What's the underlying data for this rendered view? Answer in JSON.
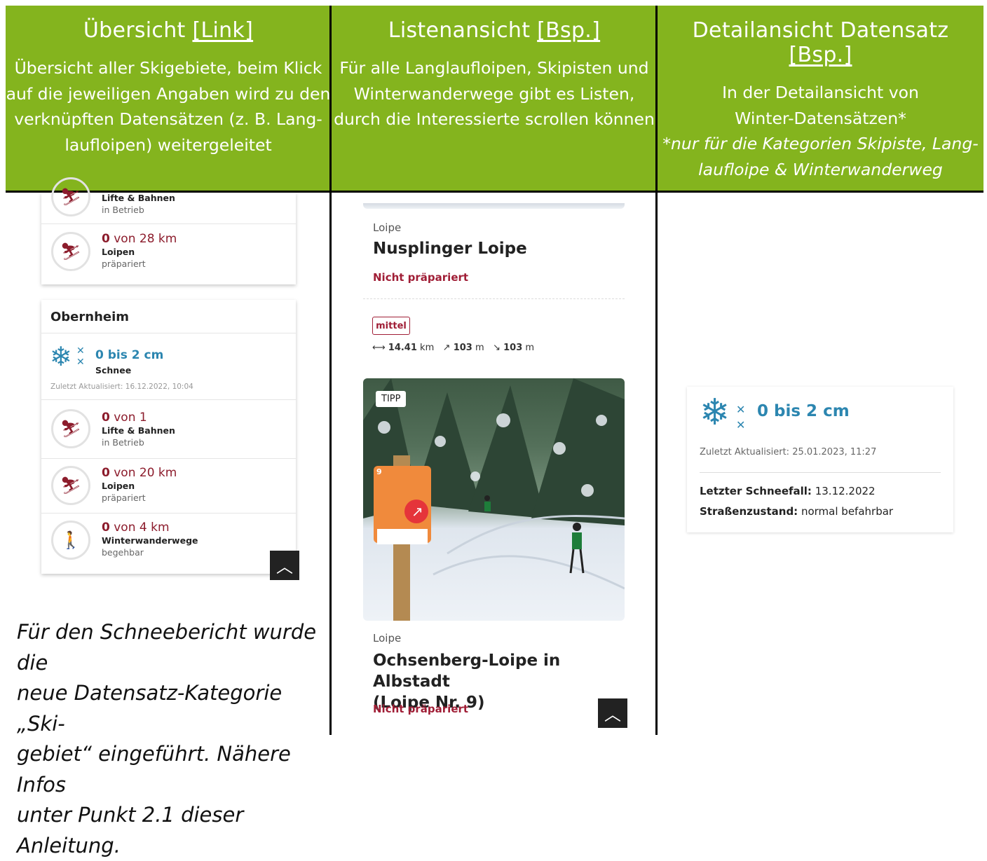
{
  "columns": [
    {
      "title": "Übersicht",
      "link": "[Link]",
      "desc": [
        "Übersicht aller Skigebiete, beim Klick",
        "auf die jeweiligen Angaben wird zu den",
        "verknüpften Datensätzen (z. B. Lang-",
        "laufloipen) weitergeleitet"
      ]
    },
    {
      "title": "Listenansicht",
      "link": "[Bsp.]",
      "desc": [
        "Für alle Langlaufloipen, Skipisten und",
        "Winterwanderwege gibt es Listen,",
        "durch die Interessierte scrollen können"
      ]
    },
    {
      "title": "Detailansicht Datensatz",
      "link": "[Bsp.]",
      "desc": [
        "In der Detailansicht von",
        "Winter-Datensätzen*"
      ],
      "desc_italic": [
        "*nur für die Kategorien Skipiste, Lang-",
        "laufloipe & Winterwanderweg"
      ]
    }
  ],
  "overview": {
    "top_card": {
      "lifts_label": "Lifte & Bahnen",
      "lifts_status": "in Betrieb",
      "trails_num": "0",
      "trails_rest": " von 28 km",
      "trails_label": "Loipen",
      "trails_status": "präpariert"
    },
    "obernheim": {
      "name": "Obernheim",
      "snow_value": "0 bis 2 cm",
      "snow_label": "Schnee",
      "updated": "Zuletzt Aktualisiert: 16.12.2022, 10:04",
      "lifts_num": "0",
      "lifts_rest": " von 1",
      "lifts_label": "Lifte & Bahnen",
      "lifts_status": "in Betrieb",
      "trails_num": "0",
      "trails_rest": " von 20 km",
      "trails_label": "Loipen",
      "trails_status": "präpariert",
      "walk_num": "0",
      "walk_rest": " von 4 km",
      "walk_label": "Winterwanderwege",
      "walk_status": "begehbar"
    },
    "up_icon": "chevron-up-icon",
    "caption": [
      "Für den Schneebericht wurde die",
      "neue Datensatz-Kategorie „Ski-",
      "gebiet“ eingeführt. Nähere Infos",
      "unter Punkt 2.1 dieser Anleitung."
    ]
  },
  "list": {
    "item1": {
      "category": "Loipe",
      "name": "Nusplinger Loipe",
      "status": "Nicht präpariert",
      "difficulty": "mittel",
      "distance": "14.41",
      "distance_unit": "km",
      "ascent": "103",
      "ascent_unit": "m",
      "descent": "103",
      "descent_unit": "m"
    },
    "item2": {
      "badge": "TIPP",
      "category": "Loipe",
      "name_l1": "Ochsenberg-Loipe in Albstadt",
      "name_l2": "(Loipe Nr. 9)",
      "status": "Nicht präpariert",
      "sign_number": "9"
    }
  },
  "detail": {
    "snow_value": "0 bis 2 cm",
    "updated": "Zuletzt Aktualisiert: 25.01.2023, 11:27",
    "last_snow_label": "Letzter Schneefall:",
    "last_snow_value": "13.12.2022",
    "road_label": "Straßenzustand:",
    "road_value": "normal befahrbar"
  },
  "colors": {
    "header_green": "#84b41e",
    "accent_red": "#a01e36",
    "snow_blue": "#2c86b0"
  }
}
